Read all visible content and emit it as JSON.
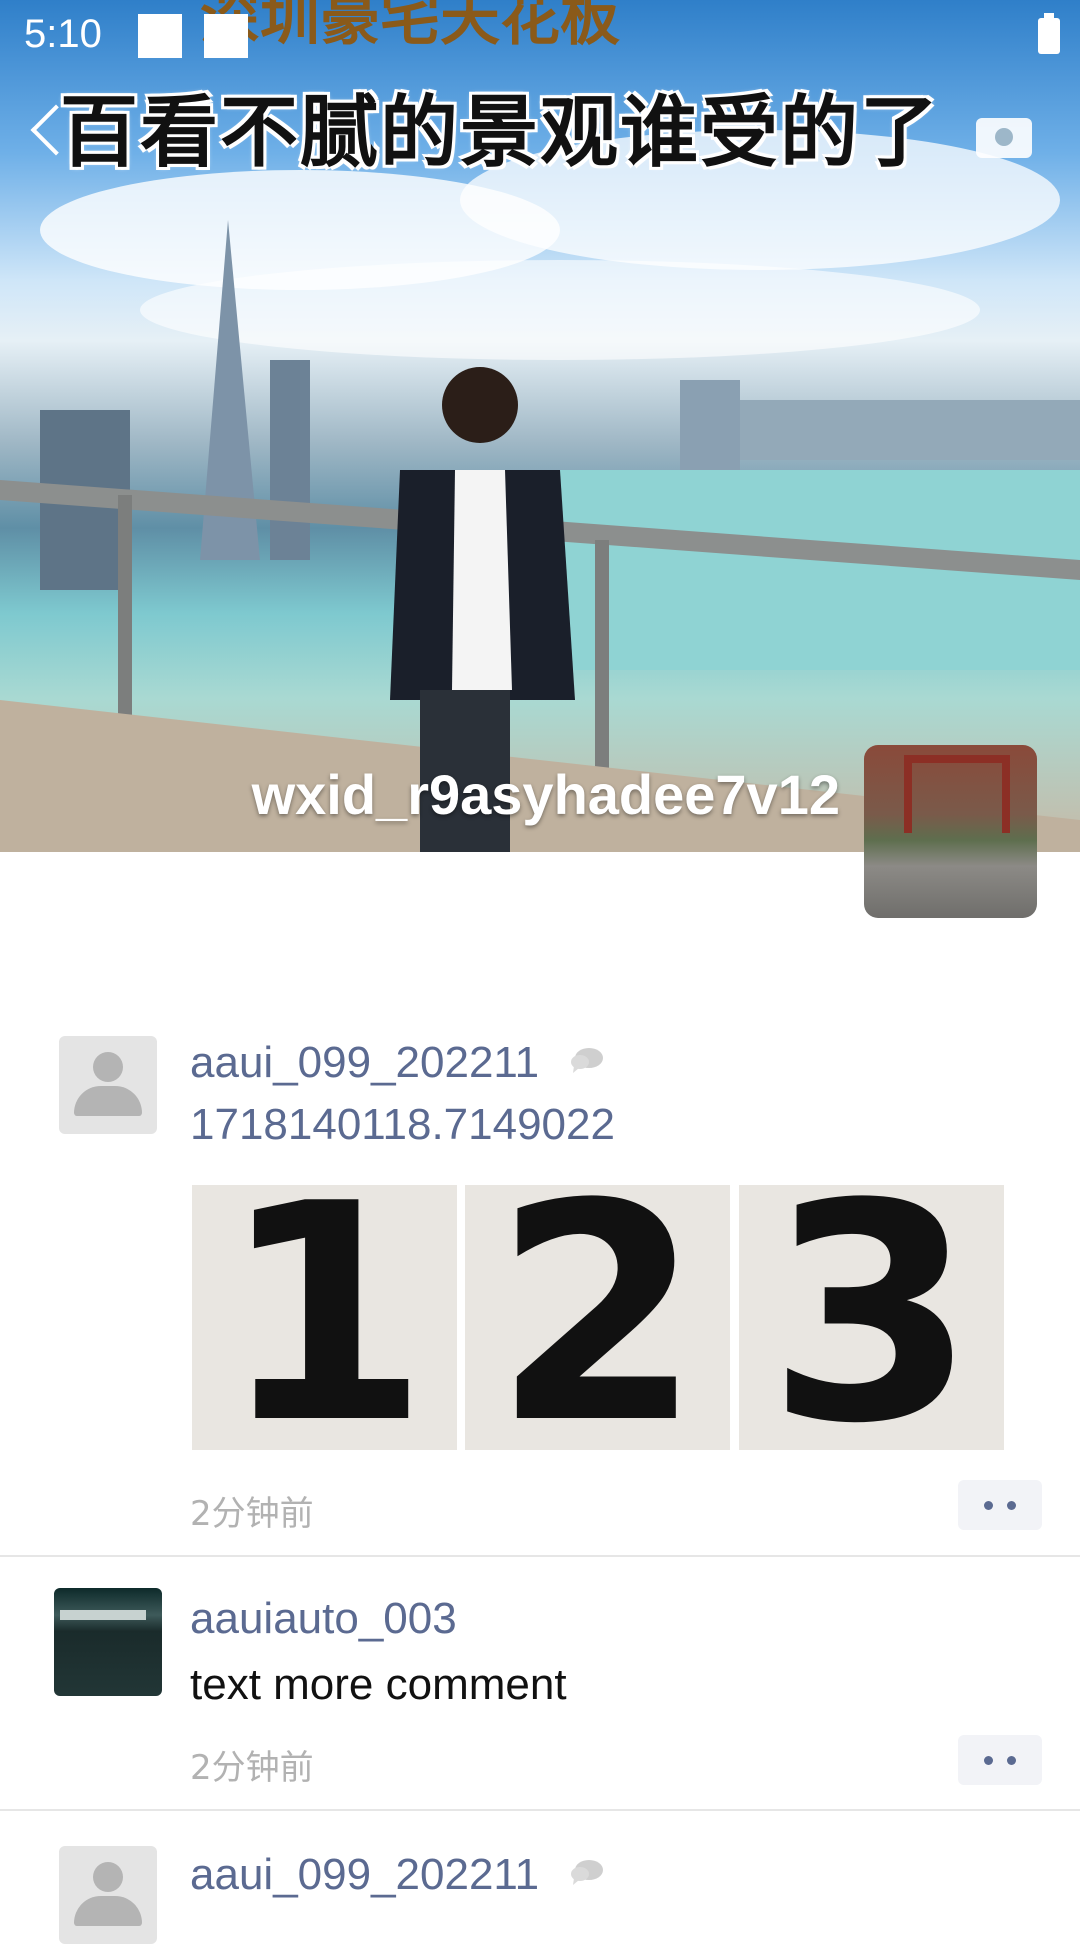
{
  "status_bar": {
    "time": "5:10"
  },
  "cover": {
    "banner_top": "深圳豪宅天花板",
    "banner_text": "百看不腻的景观谁受的了",
    "username": "wxid_r9asyhadee7v12"
  },
  "posts": [
    {
      "author": "aaui_099_202211",
      "text": "1718140118.7149022",
      "photos": [
        "1",
        "2",
        "3"
      ],
      "time": "2分钟前"
    },
    {
      "author": "aauiauto_003",
      "text": "text more comment",
      "time": "2分钟前"
    },
    {
      "author": "aaui_099_202211"
    }
  ],
  "colors": {
    "link": "#5b6a91",
    "muted": "#b2b2b2",
    "text": "#111111"
  }
}
